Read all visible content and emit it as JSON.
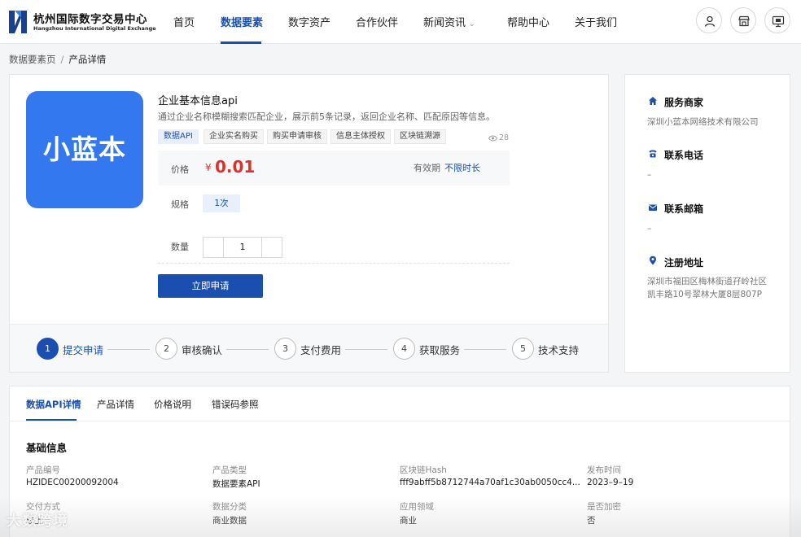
{
  "header": {
    "logo_cn": "杭州国际数字交易中心",
    "logo_en": "Hangzhou International Digital Exchange",
    "nav": [
      "首页",
      "数据要素",
      "数字资产",
      "合作伙伴",
      "新闻资讯",
      "帮助中心",
      "关于我们"
    ],
    "active_nav": "数据要素",
    "icons": [
      "user-icon",
      "store-icon",
      "monitor-icon"
    ]
  },
  "breadcrumb": {
    "root": "数据要素页",
    "sep": "/",
    "current": "产品详情"
  },
  "product": {
    "image_text": "小蓝本",
    "title": "企业基本信息api",
    "description": "通过企业名称模糊搜索匹配企业，展示前5条记录，返回企业名称、匹配原因等信息。",
    "tags": [
      "数据API",
      "企业实名购买",
      "购买申请审核",
      "信息主体授权",
      "区块链溯源"
    ],
    "views": "28",
    "price_label": "价格",
    "currency": "¥",
    "price": "0.01",
    "valid_label": "有效期",
    "valid_value": "不限时长",
    "spec_label": "规格",
    "spec_value": "1次",
    "qty_label": "数量",
    "qty_value": "1",
    "apply_label": "立即申请"
  },
  "steps": [
    {
      "num": "1",
      "label": "提交申请",
      "active": true
    },
    {
      "num": "2",
      "label": "审核确认"
    },
    {
      "num": "3",
      "label": "支付费用"
    },
    {
      "num": "4",
      "label": "获取服务"
    },
    {
      "num": "5",
      "label": "技术支持"
    }
  ],
  "provider": {
    "merchant_label": "服务商家",
    "merchant_value": "深圳小蓝本网络技术有限公司",
    "phone_label": "联系电话",
    "phone_value": "–",
    "email_label": "联系邮箱",
    "email_value": "–",
    "address_label": "注册地址",
    "address_line1": "深圳市福田区梅林街道孖岭社区",
    "address_line2": "凯丰路10号翠林大厦8层807P"
  },
  "tabs": [
    "数据API详情",
    "产品详情",
    "价格说明",
    "错误码参照"
  ],
  "basic_info": {
    "title": "基础信息",
    "fields": [
      {
        "label": "产品编号",
        "value": "HZIDEC00200092004"
      },
      {
        "label": "产品类型",
        "value": "数据要素API"
      },
      {
        "label": "区块链Hash",
        "value": "fff9abff5b8712744a70af1c30ab0050cc4..."
      },
      {
        "label": "发布时间",
        "value": "2023–9–19"
      },
      {
        "label": "交付方式",
        "value": "线上"
      },
      {
        "label": "数据分类",
        "value": "商业数据"
      },
      {
        "label": "应用领域",
        "value": "商业"
      },
      {
        "label": "是否加密",
        "value": "否"
      }
    ]
  },
  "watermark": "大数跨境",
  "colors": {
    "primary": "#1a4fb0",
    "price": "#e0302b",
    "product_bg": "#3478f0"
  }
}
